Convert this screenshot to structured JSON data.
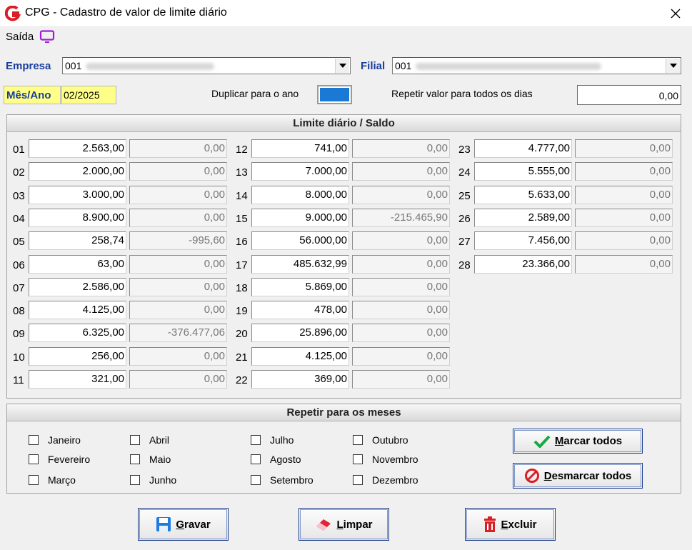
{
  "window": {
    "title": "CPG - Cadastro de valor de limite diário",
    "close_icon": "close-icon"
  },
  "menu": {
    "saida_label": "Saída"
  },
  "empresa": {
    "label": "Empresa",
    "value": "001"
  },
  "filial": {
    "label": "Filial",
    "value": "001"
  },
  "mesano": {
    "label": "Mês/Ano",
    "value": "02/2025"
  },
  "duplicar": {
    "label": "Duplicar para o ano"
  },
  "repetir_valor": {
    "label": "Repetir valor para todos os dias",
    "value": "0,00"
  },
  "limite": {
    "header": "Limite diário / Saldo",
    "days": [
      {
        "day": "01",
        "valor": "2.563,00",
        "saldo": "0,00"
      },
      {
        "day": "02",
        "valor": "2.000,00",
        "saldo": "0,00"
      },
      {
        "day": "03",
        "valor": "3.000,00",
        "saldo": "0,00"
      },
      {
        "day": "04",
        "valor": "8.900,00",
        "saldo": "0,00"
      },
      {
        "day": "05",
        "valor": "258,74",
        "saldo": "-995,60"
      },
      {
        "day": "06",
        "valor": "63,00",
        "saldo": "0,00"
      },
      {
        "day": "07",
        "valor": "2.586,00",
        "saldo": "0,00"
      },
      {
        "day": "08",
        "valor": "4.125,00",
        "saldo": "0,00"
      },
      {
        "day": "09",
        "valor": "6.325,00",
        "saldo": "-376.477,06"
      },
      {
        "day": "10",
        "valor": "256,00",
        "saldo": "0,00"
      },
      {
        "day": "11",
        "valor": "321,00",
        "saldo": "0,00"
      },
      {
        "day": "12",
        "valor": "741,00",
        "saldo": "0,00"
      },
      {
        "day": "13",
        "valor": "7.000,00",
        "saldo": "0,00"
      },
      {
        "day": "14",
        "valor": "8.000,00",
        "saldo": "0,00"
      },
      {
        "day": "15",
        "valor": "9.000,00",
        "saldo": "-215.465,90"
      },
      {
        "day": "16",
        "valor": "56.000,00",
        "saldo": "0,00"
      },
      {
        "day": "17",
        "valor": "485.632,99",
        "saldo": "0,00"
      },
      {
        "day": "18",
        "valor": "5.869,00",
        "saldo": "0,00"
      },
      {
        "day": "19",
        "valor": "478,00",
        "saldo": "0,00"
      },
      {
        "day": "20",
        "valor": "25.896,00",
        "saldo": "0,00"
      },
      {
        "day": "21",
        "valor": "4.125,00",
        "saldo": "0,00"
      },
      {
        "day": "22",
        "valor": "369,00",
        "saldo": "0,00"
      },
      {
        "day": "23",
        "valor": "4.777,00",
        "saldo": "0,00"
      },
      {
        "day": "24",
        "valor": "5.555,00",
        "saldo": "0,00"
      },
      {
        "day": "25",
        "valor": "5.633,00",
        "saldo": "0,00"
      },
      {
        "day": "26",
        "valor": "2.589,00",
        "saldo": "0,00"
      },
      {
        "day": "27",
        "valor": "7.456,00",
        "saldo": "0,00"
      },
      {
        "day": "28",
        "valor": "23.366,00",
        "saldo": "0,00"
      }
    ]
  },
  "meses": {
    "header": "Repetir para os meses",
    "items": [
      "Janeiro",
      "Fevereiro",
      "Março",
      "Abril",
      "Maio",
      "Junho",
      "Julho",
      "Agosto",
      "Setembro",
      "Outubro",
      "Novembro",
      "Dezembro"
    ],
    "marcar_todos": "Marcar todos",
    "desmarcar_todos": "Desmarcar todos"
  },
  "actions": {
    "gravar": "Gravar",
    "limpar": "Limpar",
    "excluir": "Excluir"
  },
  "colors": {
    "label_blue": "#1a3e9c",
    "highlight_yellow": "#ffff88",
    "app_red": "#d81f26",
    "check_green": "#1aa845"
  }
}
